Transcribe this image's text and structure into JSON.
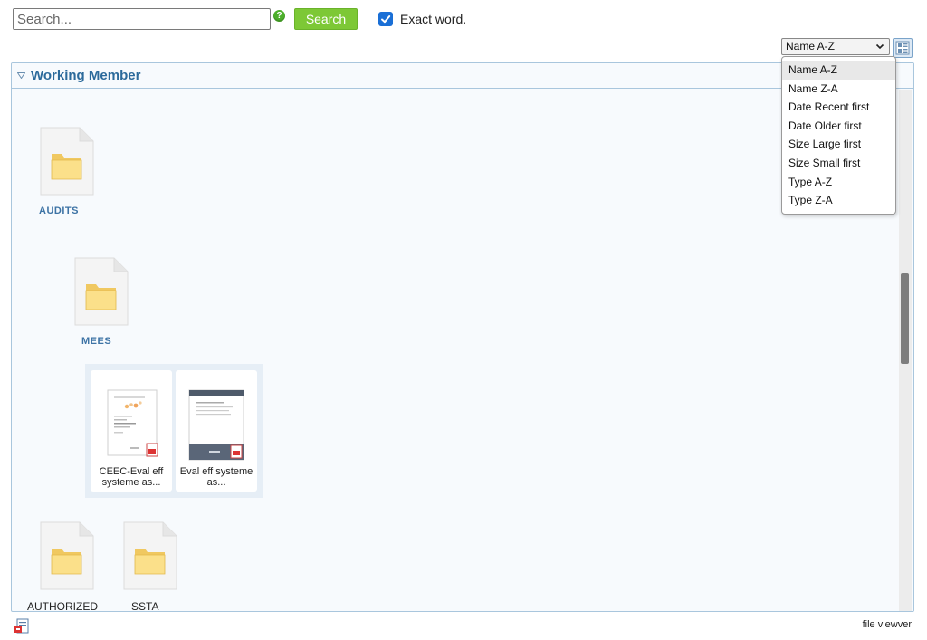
{
  "search": {
    "placeholder": "Search...",
    "value": "",
    "button_label": "Search"
  },
  "exact_word": {
    "label": "Exact word.",
    "checked": true
  },
  "sort": {
    "selected": "Name A-Z",
    "options": [
      "Name A-Z",
      "Name Z-A",
      "Date Recent first",
      "Date Older first",
      "Size Large first",
      "Size Small first",
      "Type A-Z",
      "Type Z-A"
    ]
  },
  "panel": {
    "title": "Working Member"
  },
  "folders": [
    {
      "label": "AUDITS"
    },
    {
      "label": "MEES"
    },
    {
      "label": "AUTHORIZED"
    },
    {
      "label": "SSTA"
    }
  ],
  "files": [
    {
      "name": "CEEC-Eval eff systeme as..."
    },
    {
      "name": "Eval eff systeme as..."
    }
  ],
  "footer": {
    "text": "file viewver"
  },
  "colors": {
    "accent": "#2c6a9b",
    "button_green": "#7dc836",
    "checkbox_blue": "#1a6fd6",
    "panel_border": "#a9c6dd"
  }
}
